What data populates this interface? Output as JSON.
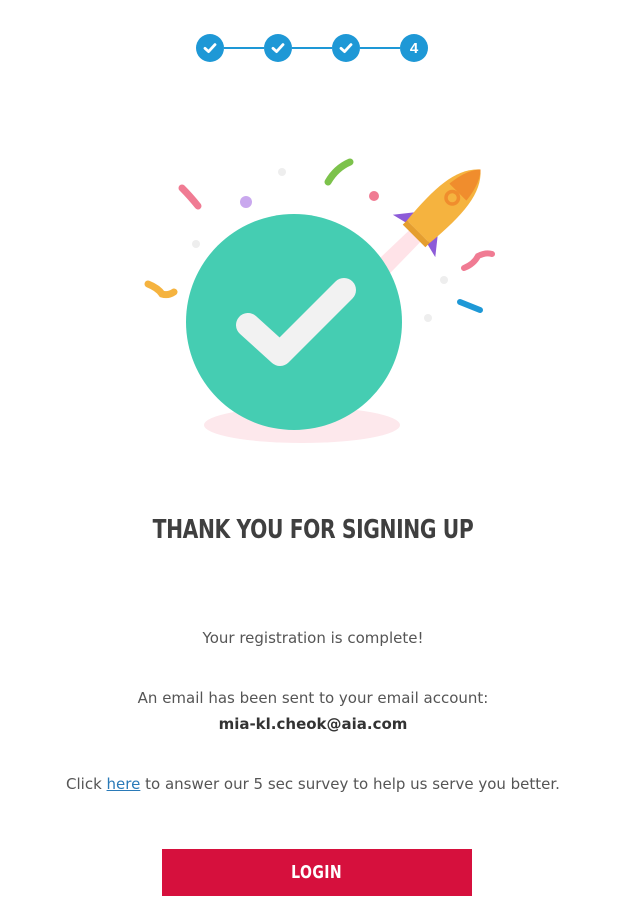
{
  "stepper": {
    "current_step_label": "4",
    "accent_color": "#1e98d6",
    "steps": [
      {
        "state": "complete",
        "icon": "check-icon"
      },
      {
        "state": "complete",
        "icon": "check-icon"
      },
      {
        "state": "complete",
        "icon": "check-icon"
      },
      {
        "state": "current",
        "label": "4"
      }
    ]
  },
  "illustration": {
    "icons": [
      "success-check-icon",
      "rocket-icon",
      "confetti-icon"
    ],
    "circle_color": "#45cdb2",
    "rocket_color": "#f5b33f"
  },
  "content": {
    "title": "THANK YOU FOR SIGNING UP",
    "registration_message": "Your registration is complete!",
    "email_message": "An email has been sent to your email account:",
    "email_address": "mia-kl.cheok@aia.com",
    "survey_prefix": "Click ",
    "survey_link": "here",
    "survey_suffix": " to answer our 5 sec survey to help us serve you better."
  },
  "actions": {
    "login_label": "LOGIN",
    "login_color": "#d6103d"
  }
}
